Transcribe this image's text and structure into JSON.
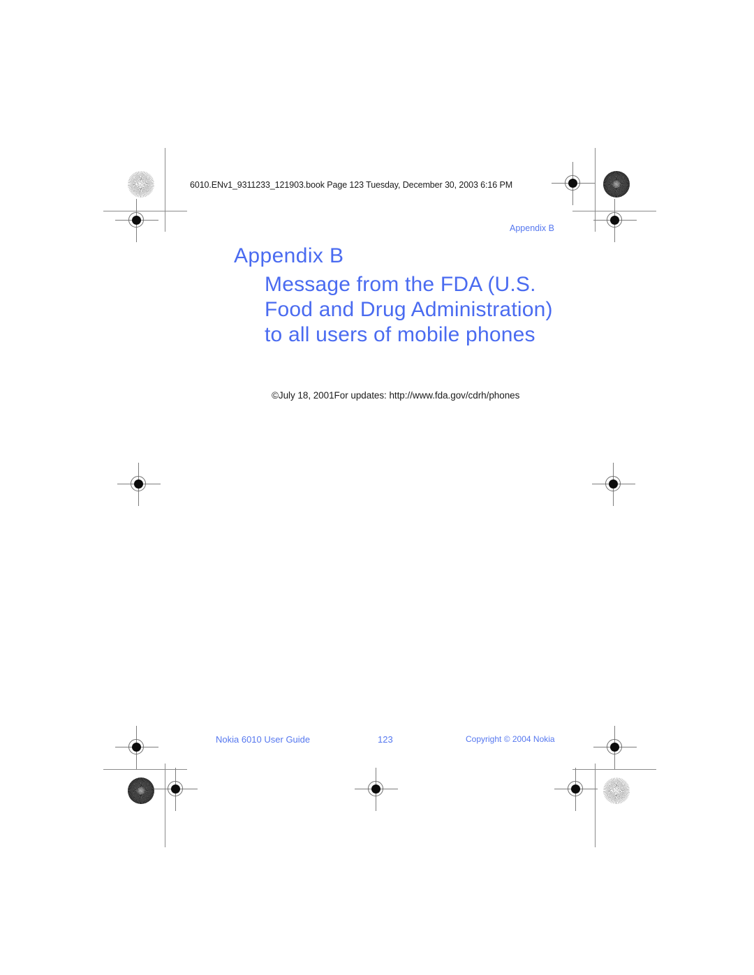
{
  "page": {
    "background_color": "#ffffff",
    "accent_blue": "#4a6bf0",
    "text_black": "#1a1a1a",
    "mark_gray": "#7d7d7d"
  },
  "running_header": {
    "text": "6010.ENv1_9311233_121903.book  Page 123  Tuesday, December 30, 2003  6:16 PM"
  },
  "folio": {
    "appendix_label": "Appendix B"
  },
  "chapter": {
    "label": "Appendix B",
    "title": "Message from the FDA (U.S. Food and Drug Administration) to all users of mobile phones"
  },
  "body": {
    "date_and_updates_line": "©July 18, 2001For updates: http://www.fda.gov/cdrh/phones"
  },
  "footer": {
    "left": "Nokia 6010 User Guide",
    "page_number": "123",
    "right": "Copyright © 2004 Nokia"
  },
  "prepress_marks": {
    "registration_targets": 10,
    "rosette_targets": 4,
    "rosette_variants": [
      "light",
      "dark",
      "dark",
      "light"
    ],
    "trim_lines": 8
  }
}
